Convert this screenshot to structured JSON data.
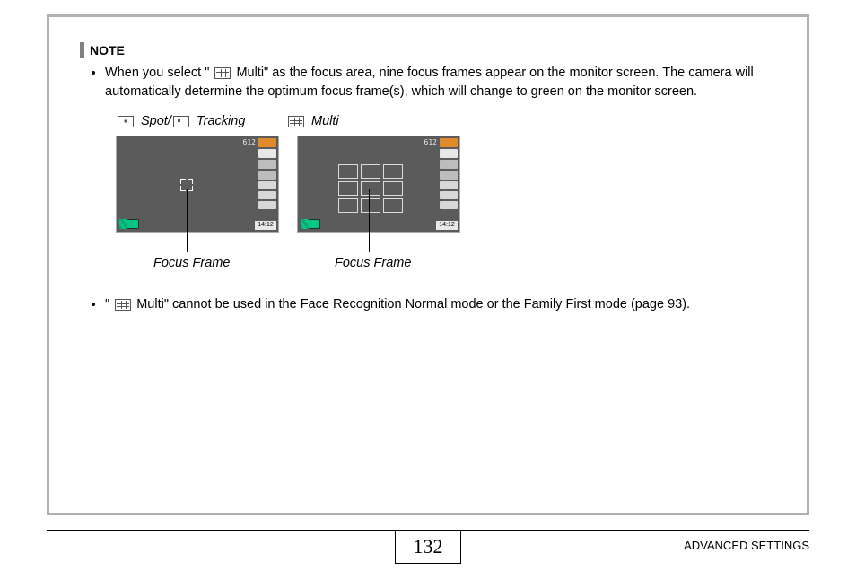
{
  "note": {
    "title": "NOTE",
    "bullet1_pre": "When you select \"",
    "bullet1_mid": " Multi\" as the focus area, nine focus frames appear on the monitor screen. The camera will automatically determine the optimum focus frame(s), which will change to green on the monitor screen.",
    "bullet2_pre": "\"",
    "bullet2_mid": " Multi\" cannot be used in the Face Recognition Normal mode or the Family First mode (page 93)."
  },
  "labels": {
    "spot": "Spot",
    "separator": " / ",
    "tracking": "Tracking",
    "multi": "Multi"
  },
  "screen_common": {
    "top_number": "612",
    "time": "14:12",
    "icons": [
      "orange",
      "5M N",
      "flash",
      "macro",
      "ISO",
      "AWB",
      "EV"
    ]
  },
  "callouts": {
    "frame1": "Focus Frame",
    "frame2": "Focus Frame"
  },
  "footer": {
    "page_number": "132",
    "section": "ADVANCED SETTINGS",
    "ref_page": "93"
  }
}
